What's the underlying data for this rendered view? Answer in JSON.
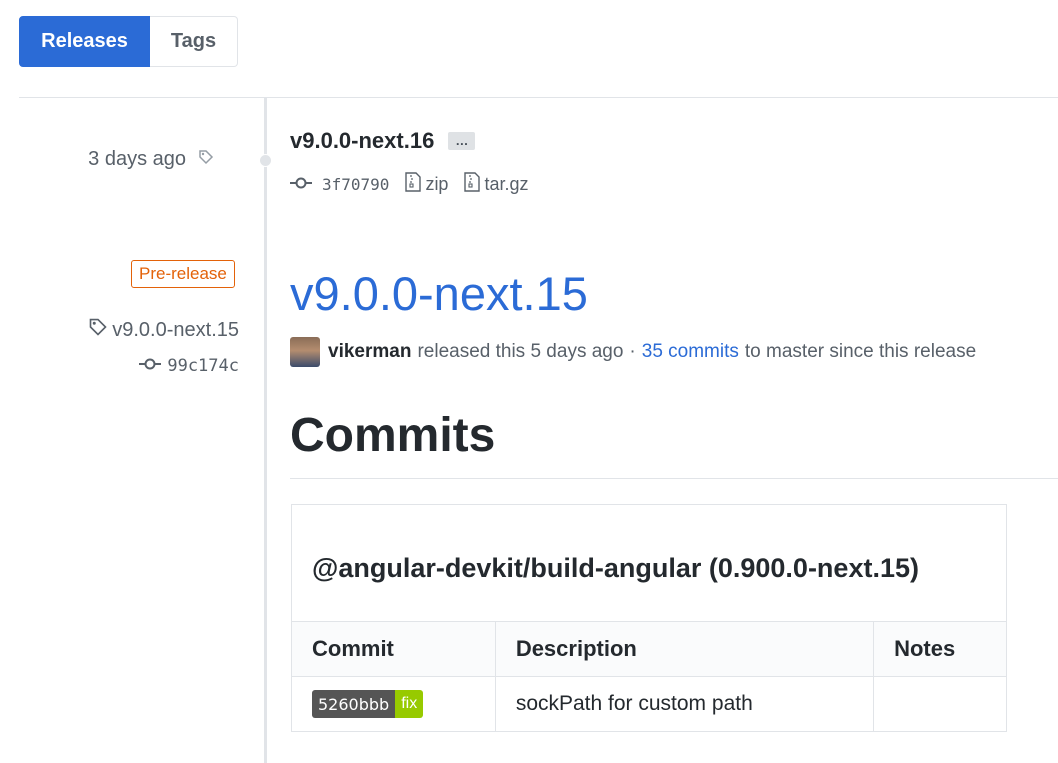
{
  "tabs": {
    "releases": "Releases",
    "tags": "Tags"
  },
  "sidebar": {
    "date": "3 days ago",
    "pre_release": "Pre-release",
    "tag_name": "v9.0.0-next.15",
    "commit_sha": "99c174c"
  },
  "release_small": {
    "title": "v9.0.0-next.16",
    "ellipsis": "…",
    "commit_sha": "3f70790",
    "zip_label": "zip",
    "targz_label": "tar.gz"
  },
  "release_main": {
    "title": "v9.0.0-next.15",
    "author": "vikerman",
    "released_text": "released this 5 days ago",
    "separator": "·",
    "commits_link": "35 commits",
    "since_text": "to master since this release"
  },
  "commits_section": {
    "heading": "Commits",
    "package": "@angular-devkit/build-angular (0.900.0-next.15)",
    "columns": [
      "Commit",
      "Description",
      "Notes"
    ],
    "rows": [
      {
        "sha": "5260bbb",
        "type": "fix",
        "description": "sockPath for custom path",
        "notes": ""
      }
    ]
  },
  "colors": {
    "accent": "#2b6bd6",
    "prerelease": "#e36209",
    "badge_fix": "#97ca00"
  }
}
